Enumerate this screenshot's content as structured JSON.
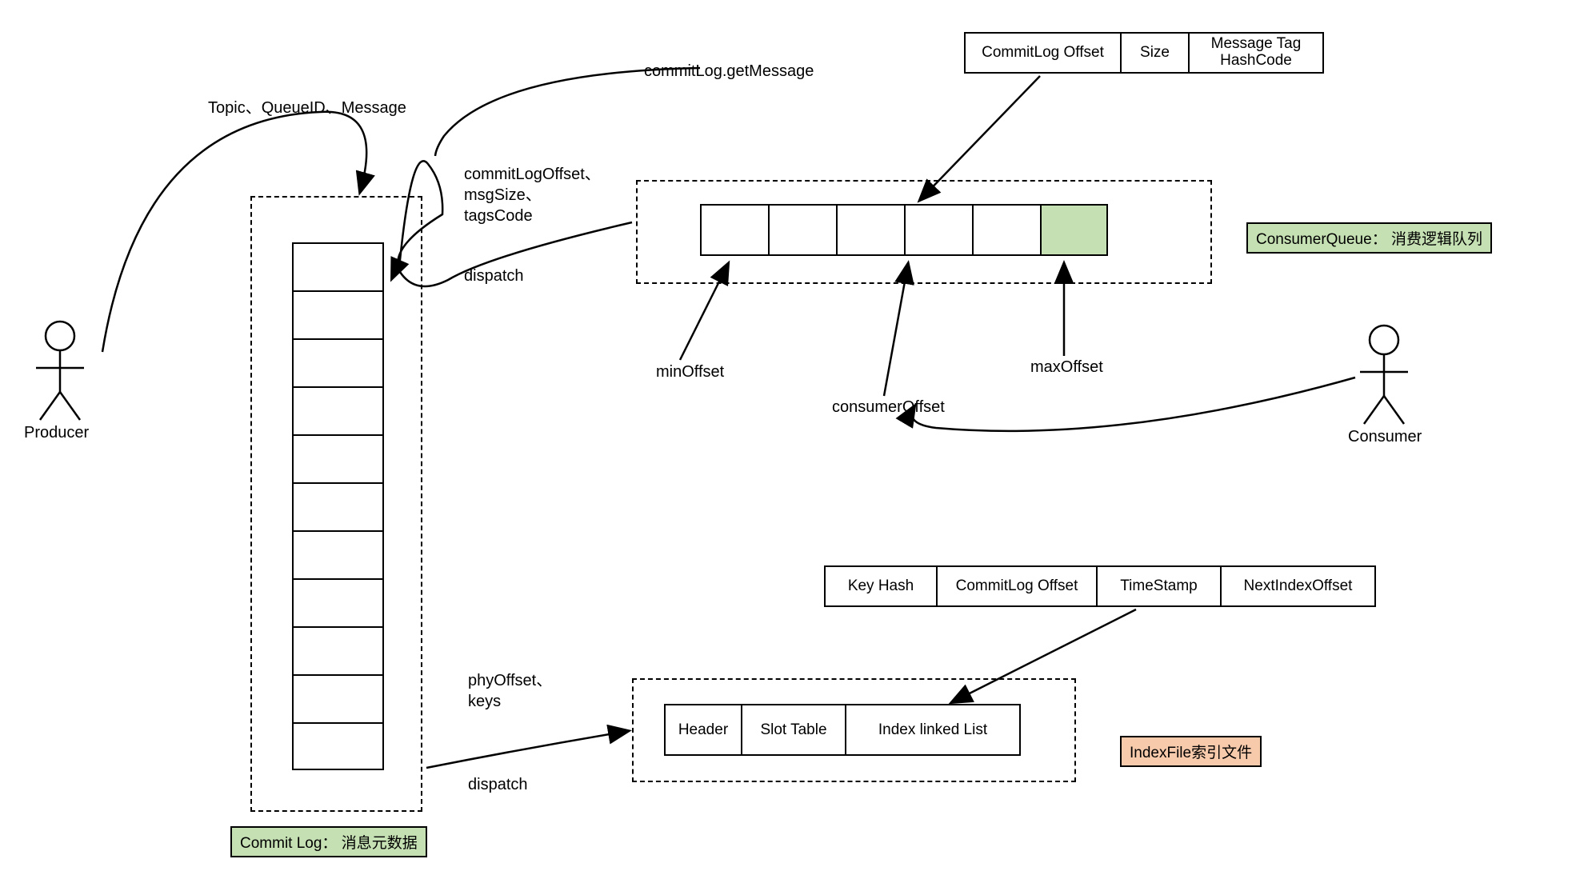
{
  "producer": {
    "label": "Producer"
  },
  "consumer": {
    "label": "Consumer"
  },
  "topicLabel": "Topic、QueueID、Message",
  "dispatch1": {
    "params": "commitLogOffset、msgSize、tagsCode",
    "action": "dispatch"
  },
  "dispatch2": {
    "params": "phyOffset、keys",
    "action": "dispatch"
  },
  "getMessage": "commitLog.getMessage",
  "cqRecord": {
    "c1": "CommitLog Offset",
    "c2": "Size",
    "c3": "Message Tag HashCode"
  },
  "offsets": {
    "min": "minOffset",
    "consumer": "consumerOffset",
    "max": "maxOffset"
  },
  "cqBadge": "ConsumerQueue： 消费逻辑队列",
  "commitLogBadge": "Commit Log： 消息元数据",
  "indexBadge": "IndexFile索引文件",
  "indexRecord": {
    "c1": "Key Hash",
    "c2": "CommitLog Offset",
    "c3": "TimeStamp",
    "c4": "NextIndexOffset"
  },
  "indexFile": {
    "c1": "Header",
    "c2": "Slot Table",
    "c3": "Index linked List"
  }
}
